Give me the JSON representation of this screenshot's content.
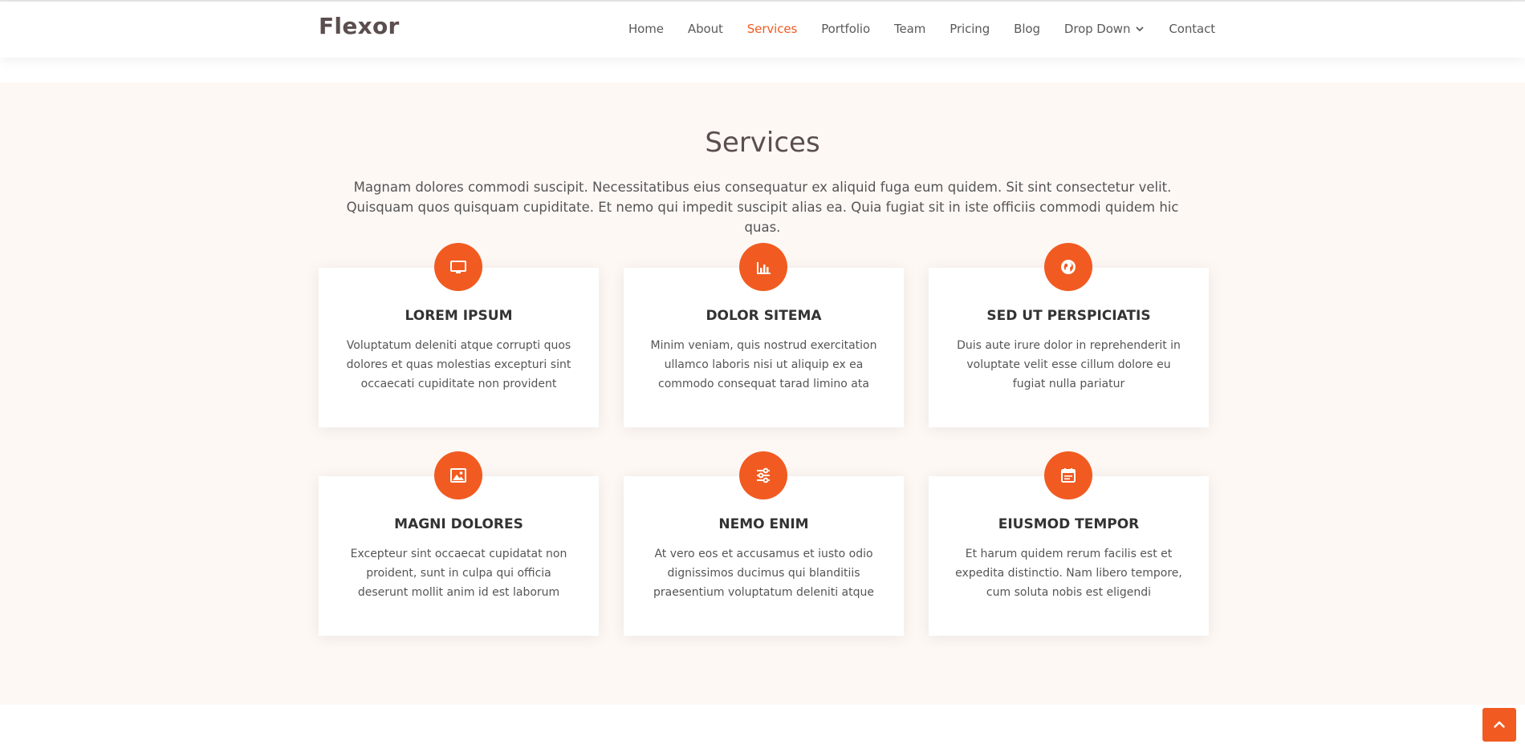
{
  "brand": {
    "name": "Flexor",
    "accent": "#f15b21"
  },
  "nav": {
    "items": [
      {
        "label": "Home"
      },
      {
        "label": "About"
      },
      {
        "label": "Services",
        "active": true
      },
      {
        "label": "Portfolio"
      },
      {
        "label": "Team"
      },
      {
        "label": "Pricing"
      },
      {
        "label": "Blog"
      },
      {
        "label": "Drop Down",
        "has_dropdown": true
      },
      {
        "label": "Contact"
      }
    ]
  },
  "services": {
    "title": "Services",
    "intro": "Magnam dolores commodi suscipit. Necessitatibus eius consequatur ex aliquid fuga eum quidem. Sit sint consectetur velit. Quisquam quos quisquam cupiditate. Et nemo qui impedit suscipit alias ea. Quia fugiat sit in iste officiis commodi quidem hic quas.",
    "cards": [
      {
        "icon": "monitor-icon",
        "title": "LOREM IPSUM",
        "text": "Voluptatum deleniti atque corrupti quos dolores et quas molestias excepturi sint occaecati cupiditate non provident"
      },
      {
        "icon": "bar-chart-icon",
        "title": "DOLOR SITEMA",
        "text": "Minim veniam, quis nostrud exercitation ullamco laboris nisi ut aliquip ex ea commodo consequat tarad limino ata"
      },
      {
        "icon": "globe-icon",
        "title": "SED UT PERSPICIATIS",
        "text": "Duis aute irure dolor in reprehenderit in voluptate velit esse cillum dolore eu fugiat nulla pariatur"
      },
      {
        "icon": "image-icon",
        "title": "MAGNI DOLORES",
        "text": "Excepteur sint occaecat cupidatat non proident, sunt in culpa qui officia deserunt mollit anim id est laborum"
      },
      {
        "icon": "sliders-icon",
        "title": "NEMO ENIM",
        "text": "At vero eos et accusamus et iusto odio dignissimos ducimus qui blanditiis praesentium voluptatum deleniti atque"
      },
      {
        "icon": "calendar-icon",
        "title": "EIUSMOD TEMPOR",
        "text": "Et harum quidem rerum facilis est et expedita distinctio. Nam libero tempore, cum soluta nobis est eligendi"
      }
    ]
  },
  "back_to_top": {
    "icon": "chevron-up-icon"
  }
}
